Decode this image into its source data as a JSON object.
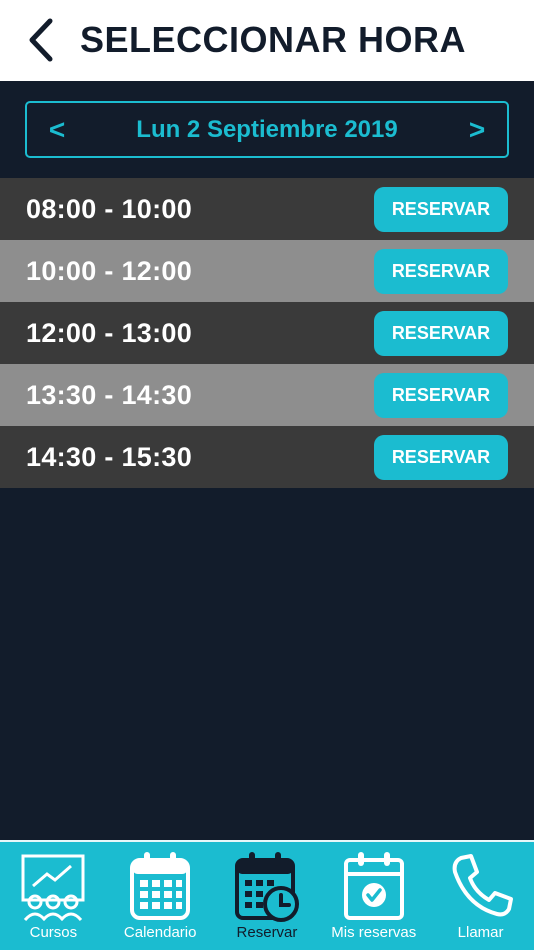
{
  "header": {
    "title": "SELECCIONAR HORA",
    "back_icon": "chevron-left-icon"
  },
  "date_selector": {
    "prev": "<",
    "label": "Lun 2 Septiembre 2019",
    "next": ">"
  },
  "slots": [
    {
      "time": "08:00 - 10:00",
      "action": "RESERVAR"
    },
    {
      "time": "10:00 - 12:00",
      "action": "RESERVAR"
    },
    {
      "time": "12:00 - 13:00",
      "action": "RESERVAR"
    },
    {
      "time": "13:30 - 14:30",
      "action": "RESERVAR"
    },
    {
      "time": "14:30 - 15:30",
      "action": "RESERVAR"
    }
  ],
  "tabbar": {
    "items": [
      {
        "label": "Cursos",
        "icon": "classroom-icon"
      },
      {
        "label": "Calendario",
        "icon": "calendar-icon"
      },
      {
        "label": "Reservar",
        "icon": "calendar-clock-icon",
        "active": true
      },
      {
        "label": "Mis reservas",
        "icon": "calendar-check-icon"
      },
      {
        "label": "Llamar",
        "icon": "phone-icon"
      }
    ]
  },
  "colors": {
    "accent": "#1bbcd0",
    "background": "#121c2b",
    "row_dark": "#3a3a3a",
    "row_light": "#8e8e8e"
  }
}
